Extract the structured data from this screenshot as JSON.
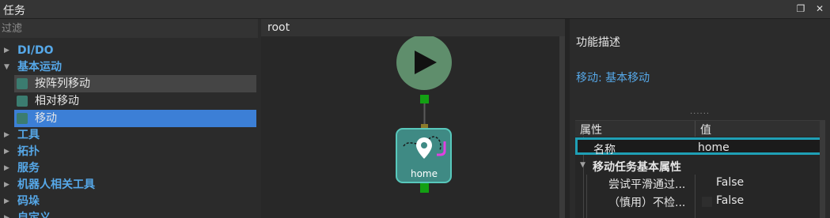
{
  "window": {
    "title": "任务"
  },
  "left": {
    "filter_placeholder": "过滤",
    "categories": [
      {
        "label": "DI/DO",
        "expanded": false
      },
      {
        "label": "基本运动",
        "expanded": true
      },
      {
        "label": "工具",
        "expanded": false
      },
      {
        "label": "拓扑",
        "expanded": false
      },
      {
        "label": "服务",
        "expanded": false
      },
      {
        "label": "机器人相关工具",
        "expanded": false
      },
      {
        "label": "码垛",
        "expanded": false
      },
      {
        "label": "自定义",
        "expanded": false
      }
    ],
    "motion_children": [
      {
        "label": "按阵列移动",
        "state": "hover"
      },
      {
        "label": "相对移动",
        "state": "normal"
      },
      {
        "label": "移动",
        "state": "selected"
      }
    ]
  },
  "center": {
    "breadcrumb": "root",
    "node_label": "home",
    "colors": {
      "start": "#5f8e6c",
      "node": "#3f8a84",
      "port": "#13a013"
    }
  },
  "right": {
    "heading": "功能描述",
    "subtitle": "移动: 基本移动",
    "grip": "......",
    "table": {
      "col_property": "属性",
      "col_value": "值",
      "rows": [
        {
          "key": "名称",
          "value": "home"
        },
        {
          "key": "移动任务基本属性",
          "value": ""
        },
        {
          "key": "尝试平滑通过...",
          "value": "False"
        },
        {
          "key": "（慎用）不检...",
          "value": "False"
        }
      ]
    }
  }
}
